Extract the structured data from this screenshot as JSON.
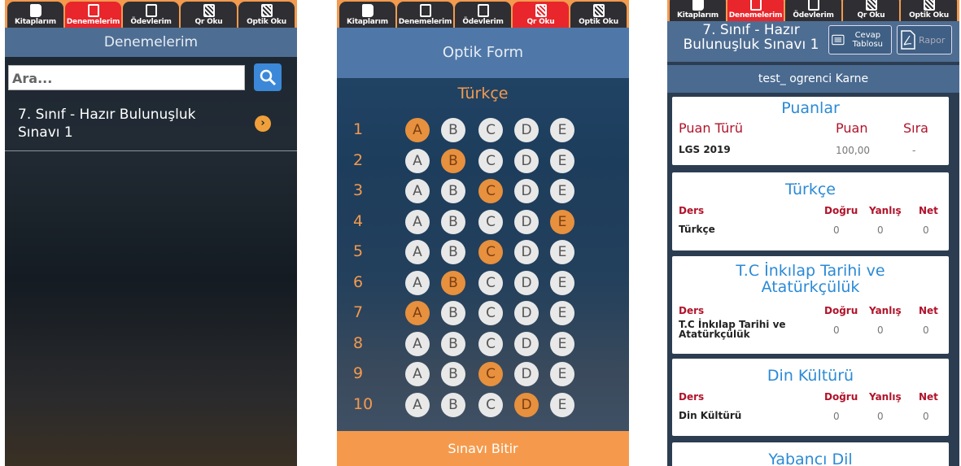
{
  "tabs": [
    "Kitaplarım",
    "Denemelerim",
    "Ödevlerim",
    "Qr Oku",
    "Optik Oku"
  ],
  "screen1": {
    "title": "Denemelerim",
    "search_placeholder": "Ara...",
    "exam": "7. Sınıf - Hazır Bulunuşluk Sınavı 1"
  },
  "screen2": {
    "title": "Optik Form",
    "section": "Türkçe",
    "options": [
      "A",
      "B",
      "C",
      "D",
      "E"
    ],
    "answers": [
      {
        "n": "1",
        "sel": "A"
      },
      {
        "n": "2",
        "sel": "B"
      },
      {
        "n": "3",
        "sel": "C"
      },
      {
        "n": "4",
        "sel": "E"
      },
      {
        "n": "5",
        "sel": "C"
      },
      {
        "n": "6",
        "sel": "B"
      },
      {
        "n": "7",
        "sel": "A"
      },
      {
        "n": "8",
        "sel": ""
      },
      {
        "n": "9",
        "sel": "C"
      },
      {
        "n": "10",
        "sel": "D"
      }
    ],
    "finish": "Sınavı Bitir"
  },
  "screen3": {
    "title": "7. Sınıf - Hazır Bulunuşluk Sınavı 1",
    "answer_table_btn": "Cevap Tablosu",
    "report_btn": "Rapor",
    "student": "test_ ogrenci Karne",
    "scores": {
      "title": "Puanlar",
      "cols": [
        "Puan Türü",
        "Puan",
        "Sıra"
      ],
      "row": [
        "LGS 2019",
        "100,00",
        "-"
      ]
    },
    "subjects": [
      {
        "title": "Türkçe",
        "name": "Türkçe",
        "d": "0",
        "y": "0",
        "n": "0"
      },
      {
        "title": "T.C İnkılap Tarihi ve Atatürkçülük",
        "name": "T.C İnkılap Tarihi ve Atatürkçülük",
        "d": "0",
        "y": "0",
        "n": "0"
      },
      {
        "title": "Din Kültürü",
        "name": "Din Kültürü",
        "d": "0",
        "y": "0",
        "n": "0"
      },
      {
        "title": "Yabancı Dil"
      }
    ],
    "col_labels": [
      "Ders",
      "Doğru",
      "Yanlış",
      "Net"
    ]
  }
}
